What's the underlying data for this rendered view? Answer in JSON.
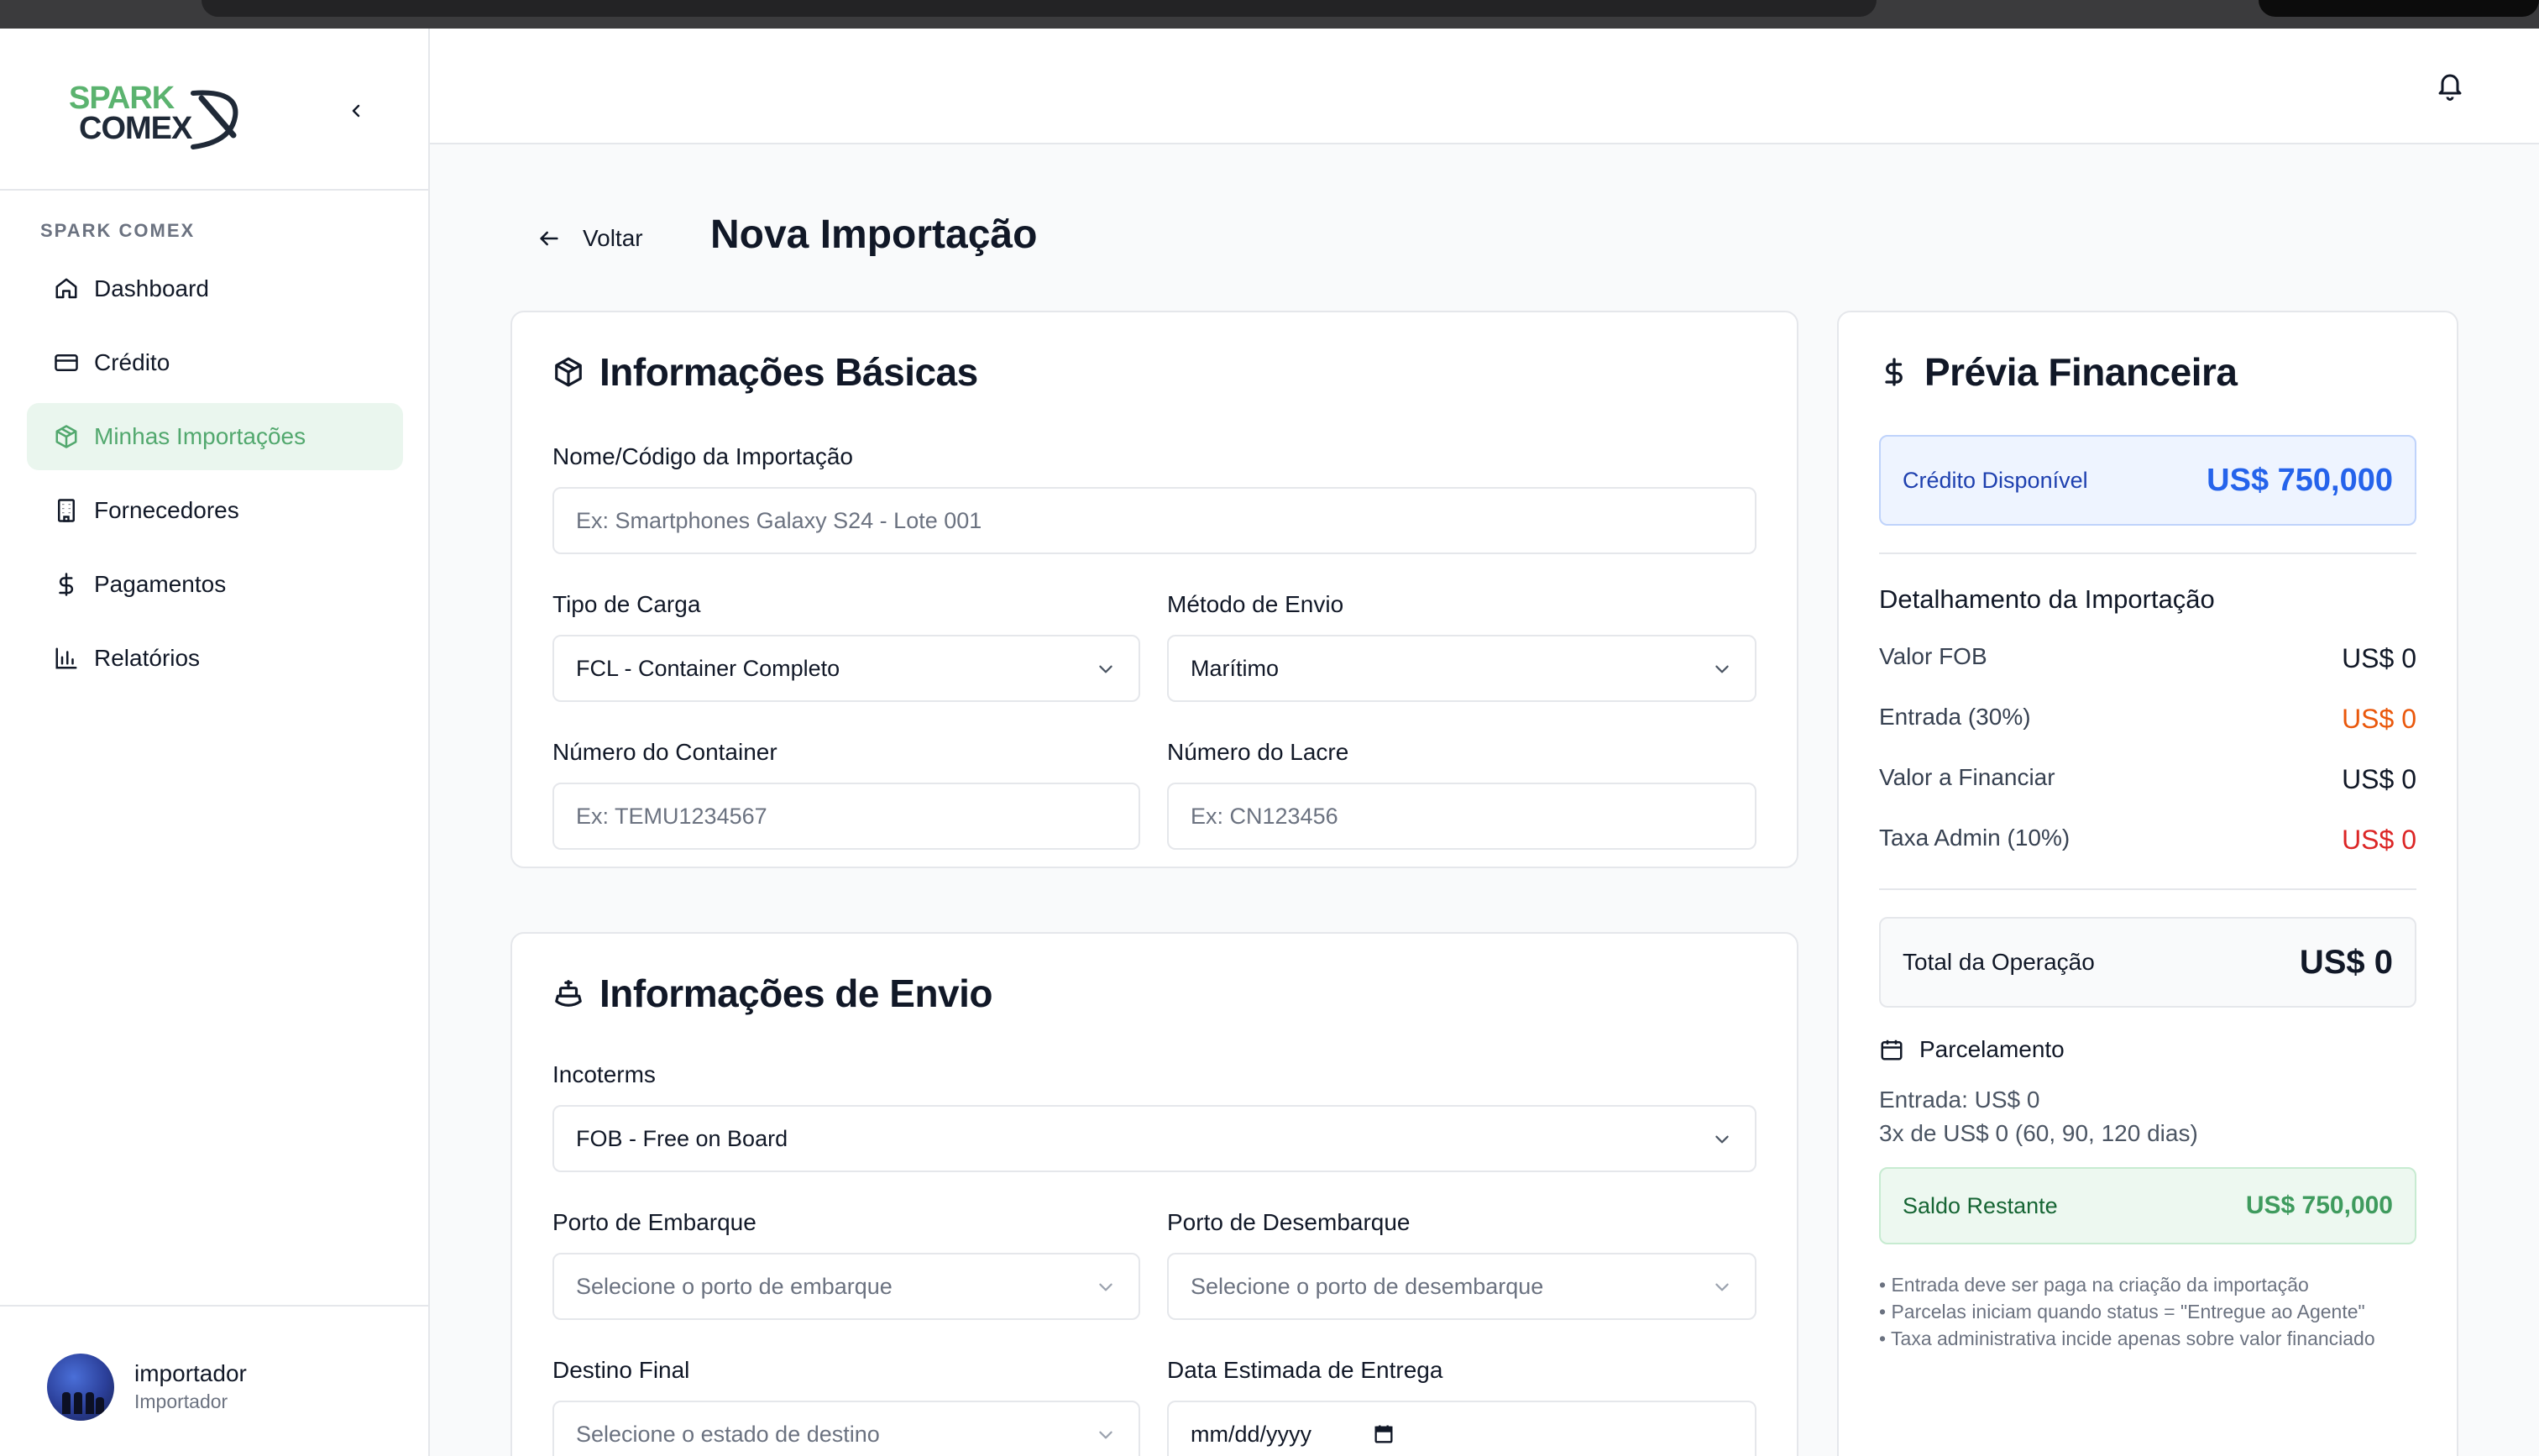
{
  "brand": {
    "logo_text_top": "SPARK",
    "logo_text_bottom": "COMEX",
    "section_label": "SPARK COMEX"
  },
  "sidebar": {
    "items": [
      {
        "label": "Dashboard",
        "icon": "home-icon",
        "active": false
      },
      {
        "label": "Crédito",
        "icon": "credit-card-icon",
        "active": false
      },
      {
        "label": "Minhas Importações",
        "icon": "package-icon",
        "active": true
      },
      {
        "label": "Fornecedores",
        "icon": "building-icon",
        "active": false
      },
      {
        "label": "Pagamentos",
        "icon": "dollar-icon",
        "active": false
      },
      {
        "label": "Relatórios",
        "icon": "bar-chart-icon",
        "active": false
      }
    ],
    "user": {
      "name": "importador",
      "role": "Importador"
    }
  },
  "header": {
    "back_label": "Voltar",
    "title": "Nova Importação"
  },
  "basic_info": {
    "title": "Informações Básicas",
    "name_label": "Nome/Código da Importação",
    "name_placeholder": "Ex: Smartphones Galaxy S24 - Lote 001",
    "cargo_label": "Tipo de Carga",
    "cargo_value": "FCL - Container Completo",
    "method_label": "Método de Envio",
    "method_value": "Marítimo",
    "container_label": "Número do Container",
    "container_placeholder": "Ex: TEMU1234567",
    "seal_label": "Número do Lacre",
    "seal_placeholder": "Ex: CN123456"
  },
  "shipping_info": {
    "title": "Informações de Envio",
    "incoterms_label": "Incoterms",
    "incoterms_value": "FOB - Free on Board",
    "loading_port_label": "Porto de Embarque",
    "loading_port_placeholder": "Selecione o porto de embarque",
    "unloading_port_label": "Porto de Desembarque",
    "unloading_port_placeholder": "Selecione o porto de desembarque",
    "destination_label": "Destino Final",
    "destination_placeholder": "Selecione o estado de destino",
    "delivery_date_label": "Data Estimada de Entrega",
    "delivery_date_placeholder": "mm/dd/yyyy"
  },
  "financial": {
    "title": "Prévia Financeira",
    "credit_label": "Crédito Disponível",
    "credit_value": "US$ 750,000",
    "breakdown_title": "Detalhamento da Importação",
    "rows": [
      {
        "label": "Valor FOB",
        "value": "US$ 0"
      },
      {
        "label": "Entrada (30%)",
        "value": "US$ 0"
      },
      {
        "label": "Valor a Financiar",
        "value": "US$ 0"
      },
      {
        "label": "Taxa Admin (10%)",
        "value": "US$ 0"
      }
    ],
    "total_label": "Total da Operação",
    "total_value": "US$ 0",
    "installments_title": "Parcelamento",
    "installments_line1": "Entrada: US$ 0",
    "installments_line2": "3x de US$ 0 (60, 90, 120 dias)",
    "balance_label": "Saldo Restante",
    "balance_value": "US$ 750,000",
    "notes": [
      "• Entrada deve ser paga na criação da importação",
      "• Parcelas iniciam quando status = \"Entregue ao Agente\"",
      "• Taxa administrativa incide apenas sobre valor financiado"
    ],
    "colors": {
      "credit": "#2563eb",
      "entrada": "#ea580c",
      "taxa": "#dc2626",
      "balance": "#3f9b5e"
    }
  }
}
